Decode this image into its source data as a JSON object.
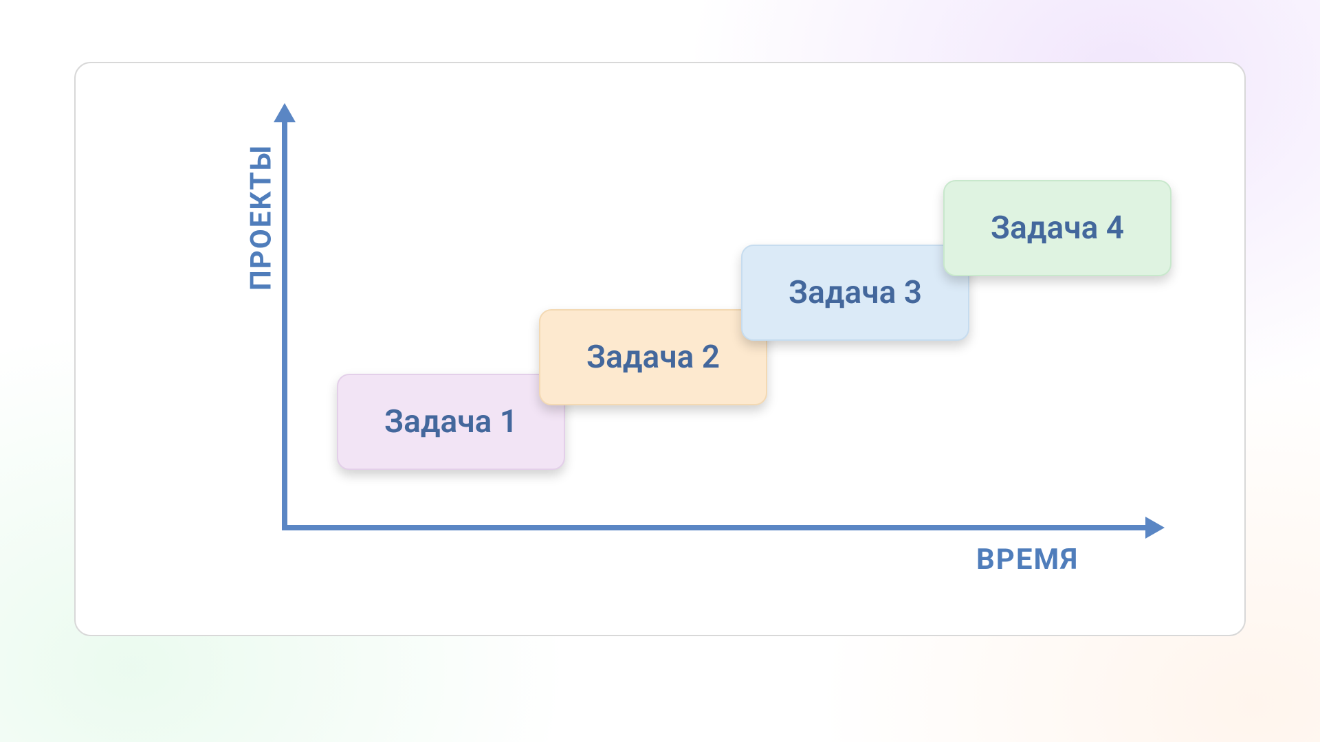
{
  "chart_data": {
    "type": "gantt",
    "xlabel": "ВРЕМЯ",
    "ylabel": "ПРОЕКТЫ",
    "series": [
      {
        "name": "Задача 1",
        "start": 1,
        "end": 2,
        "row": 1,
        "color": "#f2e4f5"
      },
      {
        "name": "Задача 2",
        "start": 2,
        "end": 3,
        "row": 2,
        "color": "#fde9cf"
      },
      {
        "name": "Задача 3",
        "start": 3,
        "end": 4,
        "row": 3,
        "color": "#dbeaf7"
      },
      {
        "name": "Задача 4",
        "start": 4,
        "end": 5,
        "row": 4,
        "color": "#dff3e1"
      }
    ],
    "xlim": [
      0,
      6
    ],
    "ylim": [
      0,
      5
    ]
  },
  "axes": {
    "x_label": "ВРЕМЯ",
    "y_label": "ПРОЕКТЫ",
    "axis_color": "#5a86c4"
  },
  "tasks": {
    "t1": {
      "label": "Задача 1"
    },
    "t2": {
      "label": "Задача 2"
    },
    "t3": {
      "label": "Задача 3"
    },
    "t4": {
      "label": "Задача 4"
    }
  }
}
